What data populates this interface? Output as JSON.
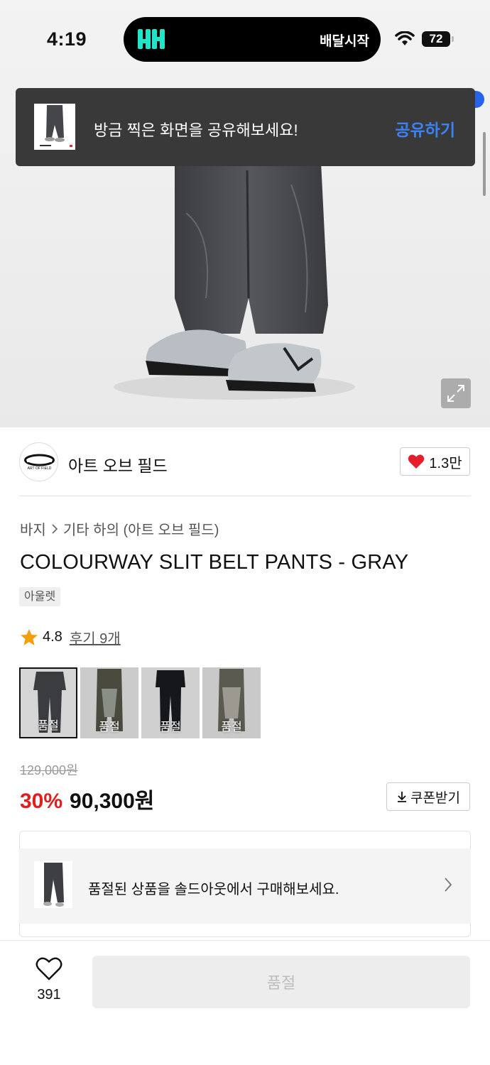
{
  "status_bar": {
    "time": "4:19",
    "island_text": "배달시작",
    "battery": "72"
  },
  "toast": {
    "message": "방금 찍은 화면을 공유해보세요!",
    "action_label": "공유하기"
  },
  "brand": {
    "name": "아트 오브 필드",
    "logo_text": "ART OF FIELD",
    "likes": "1.3만"
  },
  "breadcrumb": {
    "category": "바지",
    "subcategory": "기타 하의 (아트 오브 필드)"
  },
  "product": {
    "title": "COLOURWAY SLIT BELT PANTS - GRAY",
    "badge": "아울렛",
    "rating": "4.8",
    "review_label": "후기 9개"
  },
  "color_options": [
    {
      "label": "품절",
      "selected": true
    },
    {
      "label": "품절",
      "selected": false
    },
    {
      "label": "품절",
      "selected": false
    },
    {
      "label": "품절",
      "selected": false
    }
  ],
  "price": {
    "original": "129,000원",
    "discount": "30%",
    "final": "90,300원",
    "coupon_label": "쿠폰받기"
  },
  "soldout_banner": {
    "text": "품절된 상품을 솔드아웃에서 구매해보세요."
  },
  "bottom_bar": {
    "wish_count": "391",
    "buy_label": "품절"
  },
  "colors": {
    "accent_blue": "#3b82f6",
    "discount_red": "#e11d1d",
    "heart_red": "#e41e2b",
    "island_logo": "#1ee6c8"
  }
}
